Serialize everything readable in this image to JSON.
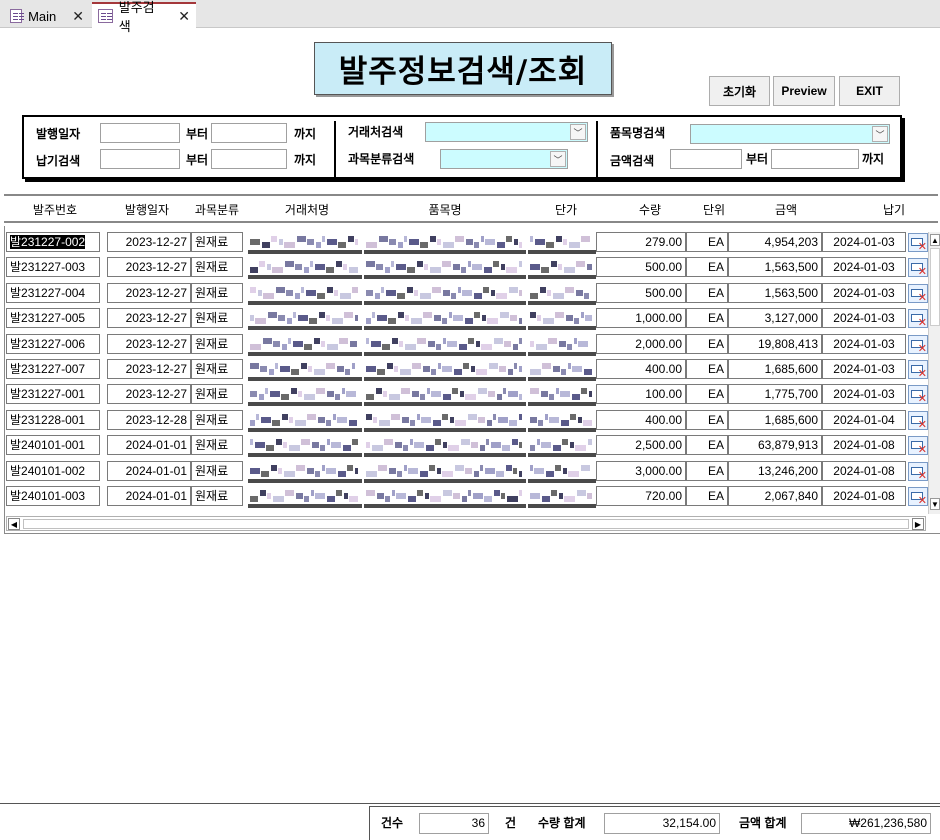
{
  "tabs": [
    {
      "label": "Main",
      "close": "✕"
    },
    {
      "label": "발주검색",
      "close": "✕"
    }
  ],
  "form": {
    "title": "발주정보검색/조회",
    "buttons": {
      "reset": "초기화",
      "preview": "Preview",
      "exit": "EXIT"
    }
  },
  "filters": {
    "issue_date": {
      "label": "발행일자",
      "from": "부터",
      "to": "까지"
    },
    "due_date": {
      "label": "납기검색",
      "from": "부터",
      "to": "까지"
    },
    "vendor": {
      "label": "거래처검색",
      "value": ""
    },
    "category": {
      "label": "과목분류검색",
      "value": ""
    },
    "item": {
      "label": "품목명검색",
      "value": ""
    },
    "amount": {
      "label": "금액검색",
      "from": "부터",
      "to": "까지"
    }
  },
  "columns": {
    "po_no": "발주번호",
    "issue_date": "발행일자",
    "category": "과목분류",
    "vendor": "거래처명",
    "item": "품목명",
    "unit_price": "단가",
    "qty": "수량",
    "unit": "단위",
    "amount": "금액",
    "due": "납기"
  },
  "rows": [
    {
      "po_no": "발231227-002",
      "issue_date": "2023-12-27",
      "category": "원재료",
      "qty": "279.00",
      "unit": "EA",
      "amount": "4,954,203",
      "due": "2024-01-03"
    },
    {
      "po_no": "발231227-003",
      "issue_date": "2023-12-27",
      "category": "원재료",
      "qty": "500.00",
      "unit": "EA",
      "amount": "1,563,500",
      "due": "2024-01-03"
    },
    {
      "po_no": "발231227-004",
      "issue_date": "2023-12-27",
      "category": "원재료",
      "qty": "500.00",
      "unit": "EA",
      "amount": "1,563,500",
      "due": "2024-01-03"
    },
    {
      "po_no": "발231227-005",
      "issue_date": "2023-12-27",
      "category": "원재료",
      "qty": "1,000.00",
      "unit": "EA",
      "amount": "3,127,000",
      "due": "2024-01-03"
    },
    {
      "po_no": "발231227-006",
      "issue_date": "2023-12-27",
      "category": "원재료",
      "qty": "2,000.00",
      "unit": "EA",
      "amount": "19,808,413",
      "due": "2024-01-03"
    },
    {
      "po_no": "발231227-007",
      "issue_date": "2023-12-27",
      "category": "원재료",
      "qty": "400.00",
      "unit": "EA",
      "amount": "1,685,600",
      "due": "2024-01-03"
    },
    {
      "po_no": "발231227-001",
      "issue_date": "2023-12-27",
      "category": "원재료",
      "qty": "100.00",
      "unit": "EA",
      "amount": "1,775,700",
      "due": "2024-01-03"
    },
    {
      "po_no": "발231228-001",
      "issue_date": "2023-12-28",
      "category": "원재료",
      "qty": "400.00",
      "unit": "EA",
      "amount": "1,685,600",
      "due": "2024-01-04"
    },
    {
      "po_no": "발240101-001",
      "issue_date": "2024-01-01",
      "category": "원재료",
      "qty": "2,500.00",
      "unit": "EA",
      "amount": "63,879,913",
      "due": "2024-01-08"
    },
    {
      "po_no": "발240101-002",
      "issue_date": "2024-01-01",
      "category": "원재료",
      "qty": "3,000.00",
      "unit": "EA",
      "amount": "13,246,200",
      "due": "2024-01-08"
    },
    {
      "po_no": "발240101-003",
      "issue_date": "2024-01-01",
      "category": "원재료",
      "qty": "720.00",
      "unit": "EA",
      "amount": "2,067,840",
      "due": "2024-01-08"
    }
  ],
  "footer": {
    "count_label": "건수",
    "count_value": "36",
    "count_unit": "건",
    "qty_label": "수량 합계",
    "qty_value": "32,154.00",
    "amount_label": "금액 합계",
    "amount_value": "₩261,236,580"
  }
}
